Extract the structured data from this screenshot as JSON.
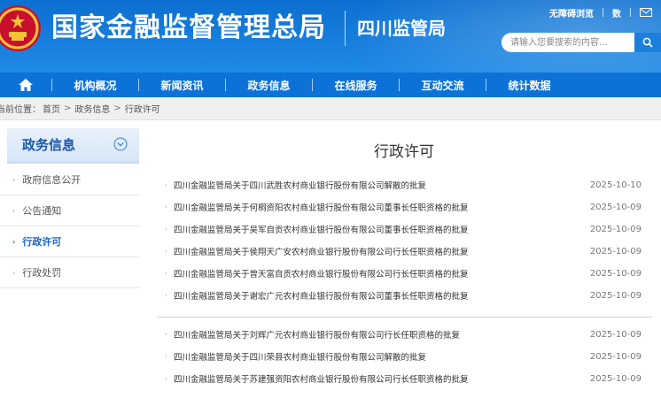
{
  "header": {
    "org_name": "国家金融监督管理总局",
    "branch_name": "四川监管局",
    "top_links": {
      "accessibility": "无障碍浏览",
      "data": "数",
      "mail_icon": "mail-icon"
    },
    "search_placeholder": "请输入您要搜索的内容...",
    "search_icon": "search-icon",
    "colors": {
      "header_blue": "#0b6fd0",
      "nav_blue": "#0d72d8"
    }
  },
  "nav": {
    "home_icon": "home-icon",
    "items": [
      "机构概况",
      "新闻资讯",
      "政务信息",
      "在线服务",
      "互动交流",
      "统计数据"
    ]
  },
  "breadcrumb": {
    "prefix": "当前位置：",
    "items": [
      "首页",
      "政务信息",
      "行政许可"
    ],
    "separator": ">"
  },
  "sidebar": {
    "title": "政务信息",
    "items": [
      {
        "label": "政府信息公开",
        "active": false
      },
      {
        "label": "公告通知",
        "active": false
      },
      {
        "label": "行政许可",
        "active": true
      },
      {
        "label": "行政处罚",
        "active": false
      }
    ],
    "active_color": "#1a64c2"
  },
  "main": {
    "title": "行政许可",
    "rows": [
      {
        "text": "四川金融监管局关于四川武胜农村商业银行股份有限公司解散的批复",
        "date": "2025-10-10"
      },
      {
        "text": "四川金融监管局关于何桐资阳农村商业银行股份有限公司董事长任职资格的批复",
        "date": "2025-10-09"
      },
      {
        "text": "四川金融监管局关于吴军自贡农村商业银行股份有限公司董事长任职资格的批复",
        "date": "2025-10-09"
      },
      {
        "text": "四川金融监管局关于侯翔天广安农村商业银行股份有限公司行长任职资格的批复",
        "date": "2025-10-09"
      },
      {
        "text": "四川金融监管局关于曾天富自贡农村商业银行股份有限公司行长任职资格的批复",
        "date": "2025-10-09"
      },
      {
        "text": "四川金融监管局关于谢宏广元农村商业银行股份有限公司董事长任职资格的批复",
        "date": "2025-10-09"
      },
      {
        "text": "四川金融监管局关于刘辉广元农村商业银行股份有限公司行长任职资格的批复",
        "date": "2025-10-09"
      },
      {
        "text": "四川金融监管局关于四川荣县农村商业银行股份有限公司解散的批复",
        "date": "2025-10-09"
      },
      {
        "text": "四川金融监管局关于苏建强资阳农村商业银行股份有限公司行长任职资格的批复",
        "date": "2025-10-09"
      }
    ]
  }
}
